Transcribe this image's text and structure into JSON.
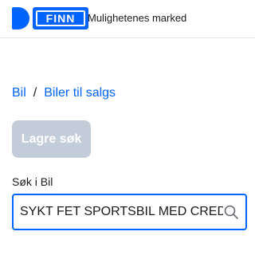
{
  "header": {
    "logo_text": "FINN",
    "tagline": "Mulighetenes marked"
  },
  "breadcrumb": {
    "items": [
      "Bil",
      "Biler til salgs"
    ],
    "separator": "/"
  },
  "actions": {
    "save_search_label": "Lagre søk"
  },
  "search": {
    "label": "Søk i Bil",
    "value": "SYKT FET SPORTSBIL MED CRED",
    "icon": "search-icon"
  },
  "colors": {
    "brand": "#0063fb",
    "button_disabled": "#c3ccd9"
  }
}
